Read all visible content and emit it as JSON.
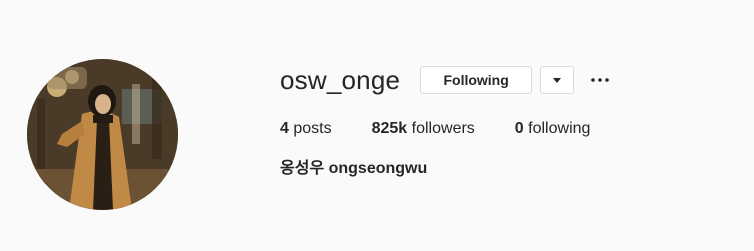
{
  "profile": {
    "username": "osw_onge",
    "full_name": "옹성우 ongseongwu",
    "avatar_icon": "profile-photo"
  },
  "actions": {
    "following_label": "Following",
    "dropdown_icon": "caret-down-icon",
    "options_icon": "more-horizontal-icon"
  },
  "stats": {
    "posts_count": "4",
    "posts_label": "posts",
    "followers_count": "825k",
    "followers_label": "followers",
    "following_count": "0",
    "following_label": "following"
  }
}
